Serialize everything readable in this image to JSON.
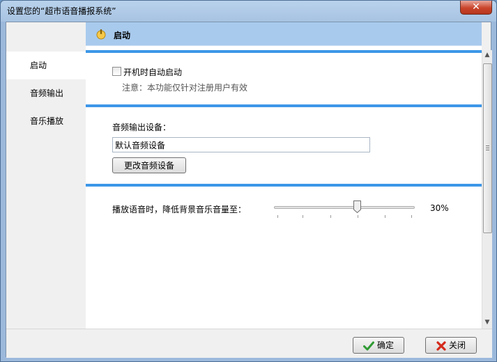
{
  "window": {
    "title": "设置您的“超市语音播报系统”",
    "close_symbol": "✕"
  },
  "nav": {
    "items": [
      "启动",
      "音频输出",
      "音乐播放"
    ],
    "active_index": 0
  },
  "header": {
    "title": "启动"
  },
  "startup": {
    "autostart_label": "开机时自动启动",
    "autostart_checked": false,
    "note": "注意：本功能仅针对注册用户有效"
  },
  "audio": {
    "device_label": "音频输出设备：",
    "device_value": "默认音频设备",
    "change_button": "更改音频设备"
  },
  "music": {
    "duck_label": "播放语音时，降低背景音乐音量至：",
    "duck_value_text": "30%",
    "duck_percent": 30
  },
  "footer": {
    "ok_label": "确定",
    "close_label": "关闭"
  },
  "colors": {
    "accent": "#3d97e8",
    "header_bg": "#a8caed",
    "title_bar": "#a7c3e2",
    "close_red": "#c9452b"
  },
  "icons": {
    "header": "power-icon",
    "ok": "checkmark-icon",
    "close": "red-x-icon"
  }
}
